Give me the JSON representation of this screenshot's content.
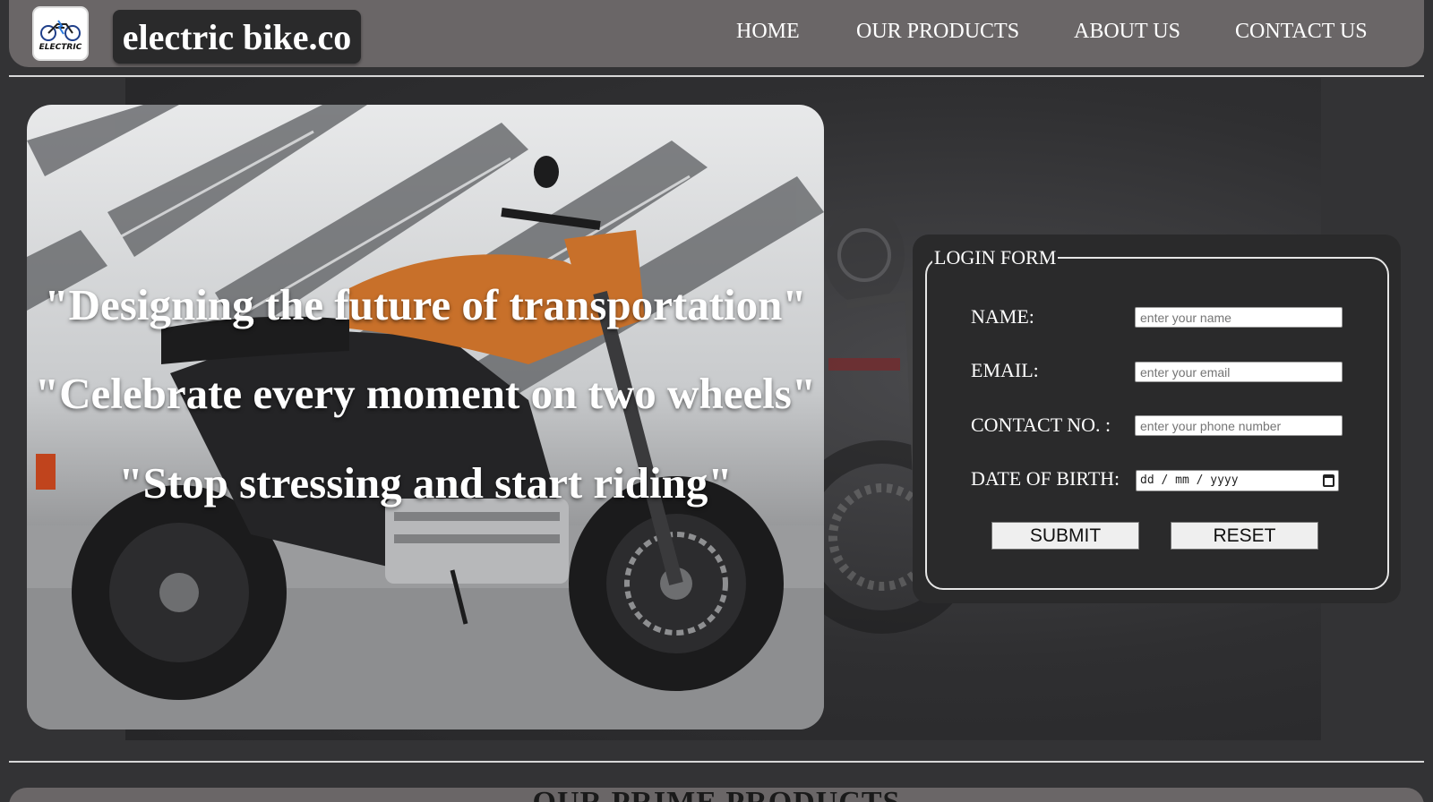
{
  "header": {
    "logo_text": "ELECTRIC",
    "brand": "electric bike.co",
    "nav": [
      "HOME",
      "OUR PRODUCTS",
      "ABOUT US",
      "CONTACT US"
    ]
  },
  "hero": {
    "quotes": [
      "\"Designing the future of transportation\"",
      "\"Celebrate every moment on two wheels\"",
      "\"Stop stressing and start riding\""
    ]
  },
  "login_form": {
    "legend": "LOGIN FORM",
    "fields": [
      {
        "label": "NAME:",
        "placeholder": "enter your name"
      },
      {
        "label": "EMAIL:",
        "placeholder": "enter your email"
      },
      {
        "label": "CONTACT NO. :",
        "placeholder": "enter your phone number"
      },
      {
        "label": "DATE OF BIRTH:",
        "placeholder": "dd / mm / yyyy"
      }
    ],
    "submit_label": "SUBMIT",
    "reset_label": "RESET"
  },
  "section": {
    "title": "OUR PRIME PRODUCTS"
  },
  "colors": {
    "background": "#333335",
    "navbar": "#6a6667",
    "brand_box": "#2a2a2b",
    "bike_accent": "#c8702a"
  },
  "icons": [
    "motorcycle-logo-icon",
    "calendar-icon"
  ]
}
